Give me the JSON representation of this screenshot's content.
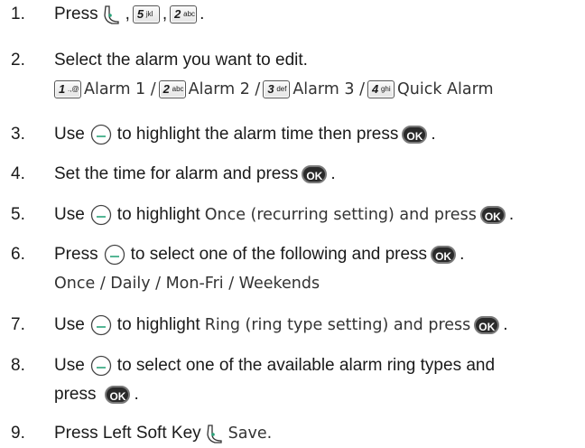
{
  "steps": [
    {
      "num": "1.",
      "parts": [
        "Press",
        ",",
        ","
      ]
    },
    {
      "num": "2.",
      "text": "Select the alarm you want to edit.",
      "alarms": [
        "Alarm 1 /",
        "Alarm 2 /",
        "Alarm 3 /",
        "Quick Alarm"
      ]
    },
    {
      "num": "3.",
      "parts": [
        "Use",
        "to highlight the alarm time then press",
        "."
      ]
    },
    {
      "num": "4.",
      "parts": [
        "Set the time for alarm and press",
        "."
      ]
    },
    {
      "num": "5.",
      "parts": [
        "Use",
        "to highlight",
        "Once (recurring setting) and press",
        "."
      ]
    },
    {
      "num": "6.",
      "parts": [
        "Press",
        "to select one of the following and press",
        "."
      ],
      "options": "Once / Daily / Mon-Fri / Weekends"
    },
    {
      "num": "7.",
      "parts": [
        "Use",
        "to highlight",
        "Ring (ring type setting) and press",
        "."
      ]
    },
    {
      "num": "8.",
      "parts": [
        "Use",
        "to select one of the available alarm ring types and"
      ],
      "line2": [
        "press",
        "."
      ]
    },
    {
      "num": "9.",
      "parts": [
        "Press Left Soft Key",
        "Save."
      ]
    }
  ],
  "keys": {
    "k1": {
      "digit": "1",
      "letters": ".,@"
    },
    "k2": {
      "digit": "2",
      "letters": "abc"
    },
    "k3": {
      "digit": "3",
      "letters": "def"
    },
    "k4": {
      "digit": "4",
      "letters": "ghi"
    },
    "k5": {
      "digit": "5",
      "letters": "jkl"
    },
    "ok": "OK"
  }
}
